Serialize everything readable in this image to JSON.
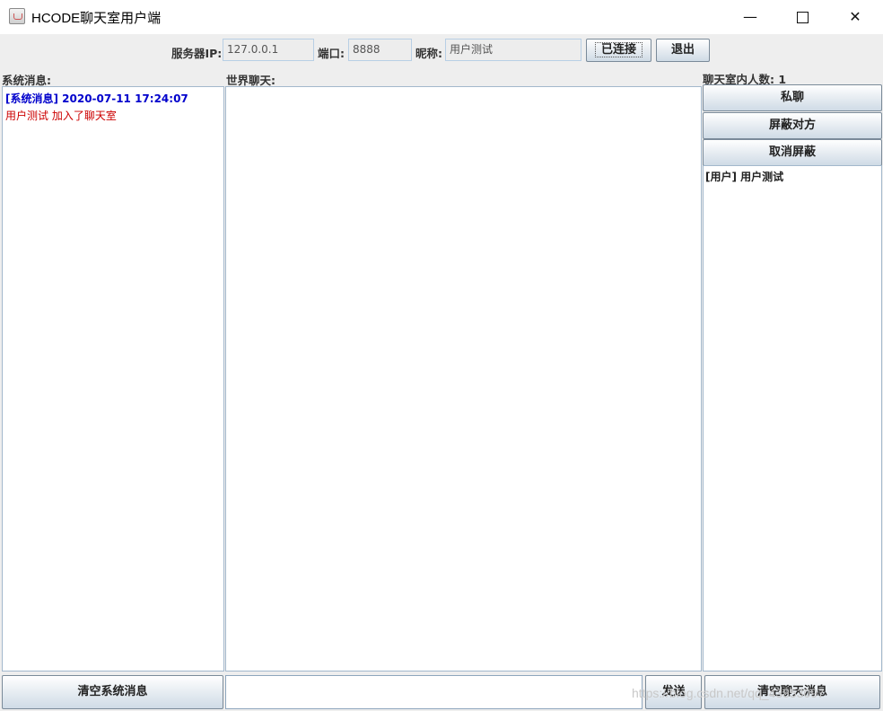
{
  "window": {
    "title": "HCODE聊天室用户端",
    "minimize_glyph": "—",
    "close_glyph": "✕"
  },
  "connection": {
    "server_ip_label": "服务器IP:",
    "server_ip_value": "127.0.0.1",
    "port_label": "端口:",
    "port_value": "8888",
    "nickname_label": "昵称:",
    "nickname_value": "用户测试",
    "connect_button": "已连接",
    "exit_button": "退出"
  },
  "system_panel": {
    "label": "系统消息:",
    "messages": [
      {
        "header": "[系统消息] 2020-07-11 17:24:07",
        "body": "用户测试 加入了聊天室"
      }
    ],
    "clear_button": "清空系统消息"
  },
  "world_chat": {
    "label": "世界聊天:",
    "input_value": "",
    "send_button": "发送"
  },
  "users_panel": {
    "count_label": "聊天室内人数: 1",
    "private_chat_button": "私聊",
    "block_button": "屏蔽对方",
    "unblock_button": "取消屏蔽",
    "users": [
      "[用户] 用户测试"
    ],
    "clear_chat_button": "清空聊天消息"
  },
  "watermark": "https://blog.csdn.net/qq_43853097",
  "icons": {
    "app": "java-coffee-cup-icon",
    "minimize": "minimize-icon",
    "maximize": "maximize-icon",
    "close": "close-icon"
  },
  "colors": {
    "system_header": "#0000cc",
    "system_body": "#cc0000",
    "panel_border": "#a3b8cc"
  }
}
